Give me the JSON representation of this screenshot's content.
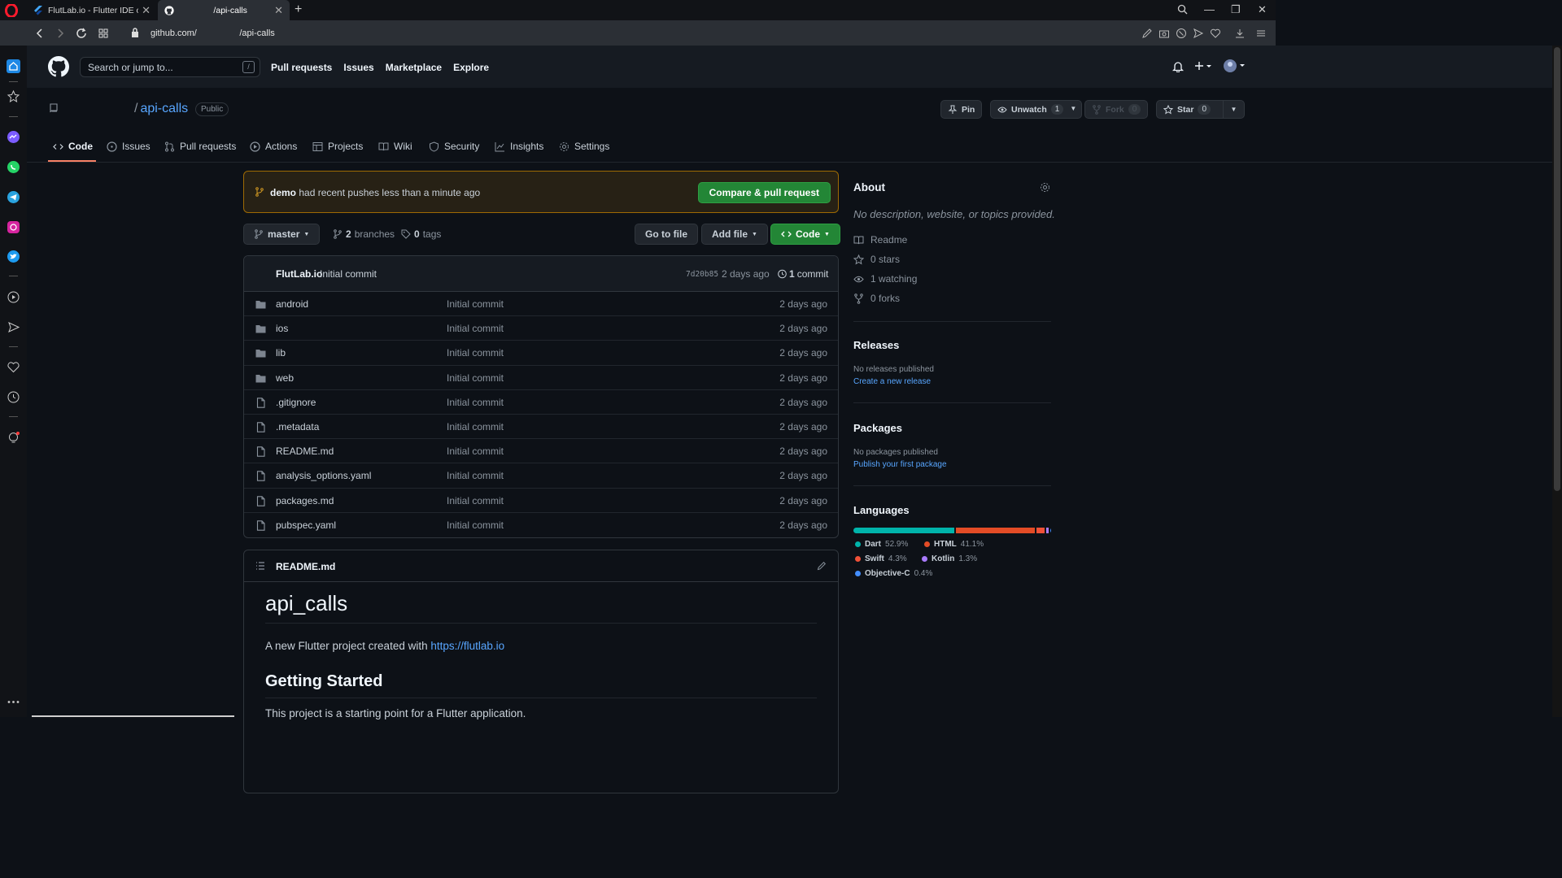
{
  "browser": {
    "tabs": [
      {
        "title": "FlutLab.io - Flutter IDE onli"
      },
      {
        "title": "⠀ ⠀ ⠀ ⠀ /api-calls"
      }
    ],
    "url": "github.com/⠀ ⠀ ⠀ ⠀ ⠀/api-calls"
  },
  "github": {
    "search_placeholder": "Search or jump to...",
    "slash_key": "/",
    "nav": [
      "Pull requests",
      "Issues",
      "Marketplace",
      "Explore"
    ]
  },
  "repo": {
    "slash": "/",
    "name": "api-calls",
    "visibility": "Public",
    "pin_label": "Pin",
    "unwatch_label": "Unwatch",
    "unwatch_count": "1",
    "fork_label": "Fork",
    "fork_count": "0",
    "star_label": "Star",
    "star_count": "0",
    "tabs": [
      "Code",
      "Issues",
      "Pull requests",
      "Actions",
      "Projects",
      "Wiki",
      "Security",
      "Insights",
      "Settings"
    ]
  },
  "push_banner": {
    "branch": "demo",
    "text": "had recent pushes less than a minute ago",
    "button": "Compare & pull request"
  },
  "toolbar": {
    "branch": "master",
    "branches_count": "2",
    "branches_label": "branches",
    "tags_count": "0",
    "tags_label": "tags",
    "go_to_file": "Go to file",
    "add_file": "Add file",
    "code": "Code"
  },
  "latest_commit": {
    "author": "FlutLab.io",
    "message": "Initial commit",
    "sha": "7d20b85",
    "when": "2 days ago",
    "commits_count": "1",
    "commits_label": "commit"
  },
  "files": [
    {
      "name": "android",
      "type": "dir",
      "commit": "Initial commit",
      "age": "2 days ago"
    },
    {
      "name": "ios",
      "type": "dir",
      "commit": "Initial commit",
      "age": "2 days ago"
    },
    {
      "name": "lib",
      "type": "dir",
      "commit": "Initial commit",
      "age": "2 days ago"
    },
    {
      "name": "web",
      "type": "dir",
      "commit": "Initial commit",
      "age": "2 days ago"
    },
    {
      "name": ".gitignore",
      "type": "file",
      "commit": "Initial commit",
      "age": "2 days ago"
    },
    {
      "name": ".metadata",
      "type": "file",
      "commit": "Initial commit",
      "age": "2 days ago"
    },
    {
      "name": "README.md",
      "type": "file",
      "commit": "Initial commit",
      "age": "2 days ago"
    },
    {
      "name": "analysis_options.yaml",
      "type": "file",
      "commit": "Initial commit",
      "age": "2 days ago"
    },
    {
      "name": "packages.md",
      "type": "file",
      "commit": "Initial commit",
      "age": "2 days ago"
    },
    {
      "name": "pubspec.yaml",
      "type": "file",
      "commit": "Initial commit",
      "age": "2 days ago"
    }
  ],
  "readme": {
    "filename": "README.md",
    "h1": "api_calls",
    "p1_text": "A new Flutter project created with ",
    "p1_link": "https://flutlab.io",
    "h2": "Getting Started",
    "p2": "This project is a starting point for a Flutter application."
  },
  "about": {
    "title": "About",
    "description": "No description, website, or topics provided.",
    "readme": "Readme",
    "stars": "0 stars",
    "watching": "1 watching",
    "forks": "0 forks"
  },
  "releases": {
    "title": "Releases",
    "note": "No releases published",
    "link": "Create a new release"
  },
  "packages": {
    "title": "Packages",
    "note": "No packages published",
    "link": "Publish your first package"
  },
  "languages": {
    "title": "Languages",
    "items": [
      {
        "name": "Dart",
        "percent": "52.9%",
        "value": 52.9,
        "color": "#00B4AB"
      },
      {
        "name": "HTML",
        "percent": "41.1%",
        "value": 41.1,
        "color": "#e34c26"
      },
      {
        "name": "Swift",
        "percent": "4.3%",
        "value": 4.3,
        "color": "#F05138"
      },
      {
        "name": "Kotlin",
        "percent": "1.3%",
        "value": 1.3,
        "color": "#A97BFF"
      },
      {
        "name": "Objective-C",
        "percent": "0.4%",
        "value": 0.4,
        "color": "#438eff"
      }
    ]
  }
}
